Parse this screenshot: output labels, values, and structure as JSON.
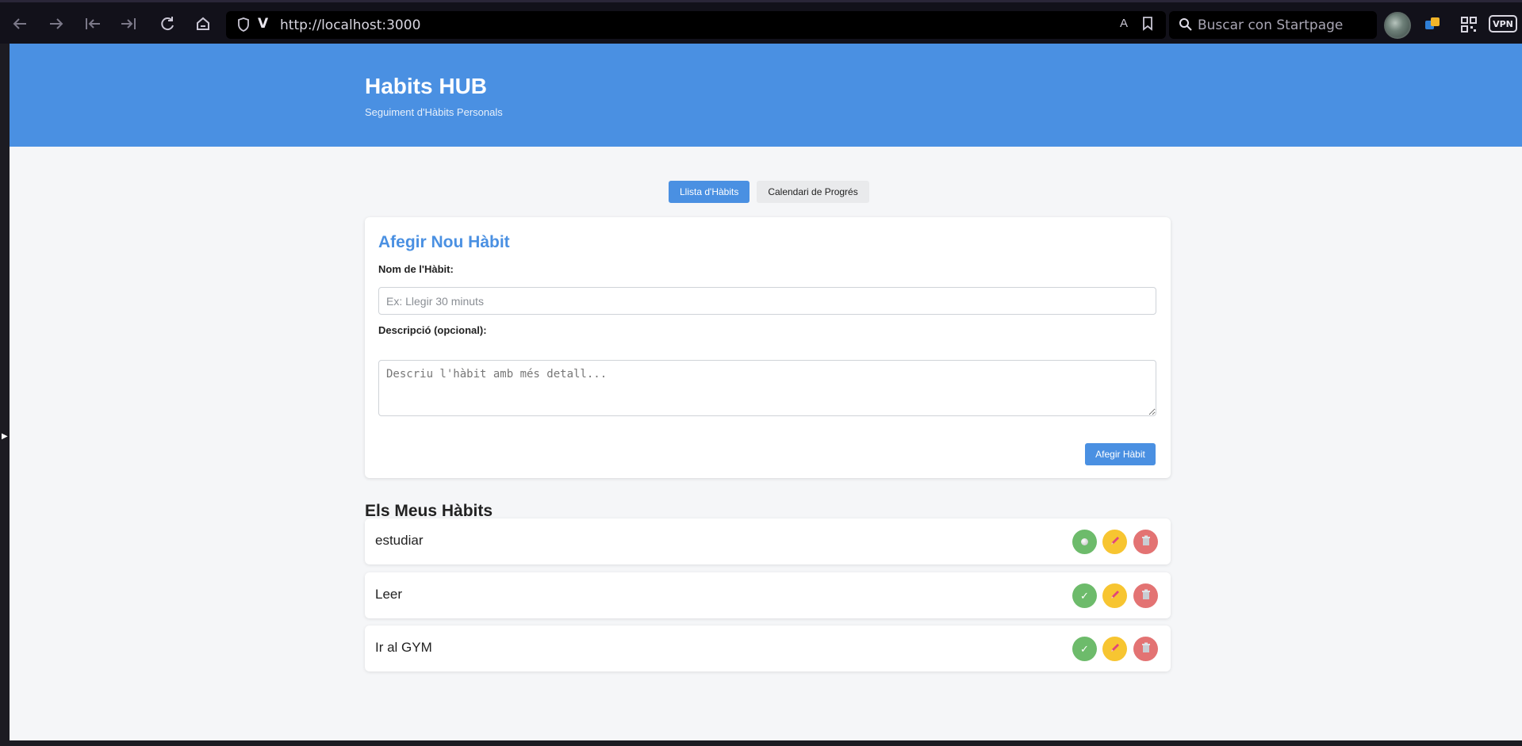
{
  "browser": {
    "url": "http://localhost:3000",
    "search_placeholder": "Buscar con Startpage",
    "vpn_label": "VPN"
  },
  "app": {
    "title": "Habits HUB",
    "subtitle": "Seguiment d'Hàbits Personals"
  },
  "tabs": [
    {
      "label": "Llista d'Hàbits",
      "active": true
    },
    {
      "label": "Calendari de Progrés",
      "active": false
    }
  ],
  "form": {
    "title": "Afegir Nou Hàbit",
    "name_label": "Nom de l'Hàbit:",
    "name_placeholder": "Ex: Llegir 30 minuts",
    "name_value": "",
    "description_label": "Descripció (opcional):",
    "description_placeholder": "Descriu l'hàbit amb més detall...",
    "description_value": "",
    "submit_label": "Afegir Hàbit"
  },
  "list": {
    "title": "Els Meus Hàbits",
    "habits": [
      {
        "name": "estudiar",
        "complete_icon": "dot-icon"
      },
      {
        "name": "Leer",
        "complete_icon": "check-icon"
      },
      {
        "name": "Ir al GYM",
        "complete_icon": "check-icon"
      }
    ]
  },
  "colors": {
    "primary": "#4a90e2",
    "complete": "#6dbb6b",
    "edit": "#f7c531",
    "delete": "#e37373"
  }
}
